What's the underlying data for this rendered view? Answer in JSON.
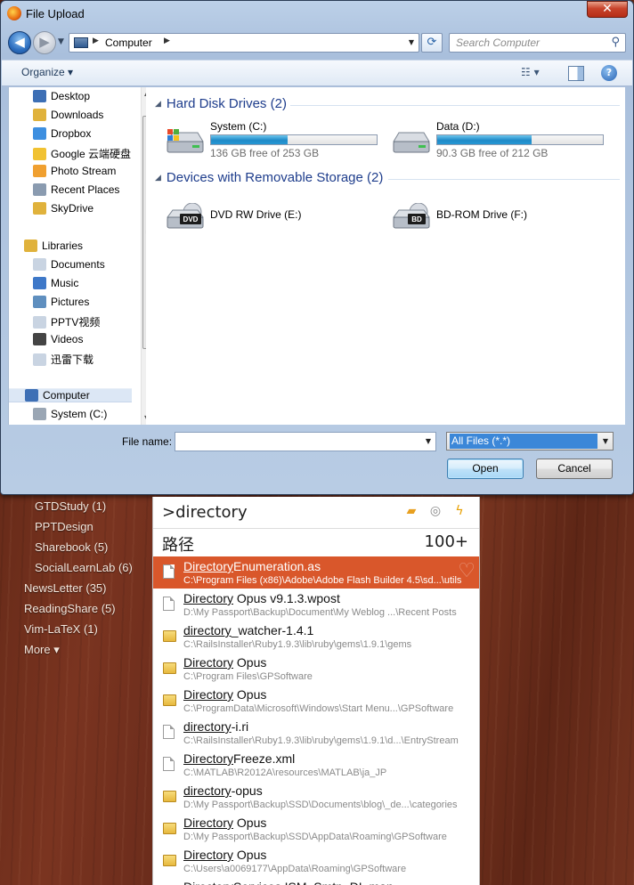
{
  "window": {
    "title": "File Upload",
    "close": "✕"
  },
  "nav": {
    "address_path": "Computer",
    "search_placeholder": "Search Computer"
  },
  "toolbar": {
    "organize_label": "Organize ▾",
    "view_label": "☷ ▾",
    "help_label": "?"
  },
  "sidebar": {
    "favorites": [
      {
        "label": "Desktop",
        "icon": "desktop-icon",
        "color": "#3d6fb5"
      },
      {
        "label": "Downloads",
        "icon": "downloads-folder-icon",
        "color": "#e0b23c"
      },
      {
        "label": "Dropbox",
        "icon": "dropbox-icon",
        "color": "#3d8fe0"
      },
      {
        "label": "Google 云端硬盘",
        "icon": "google-drive-icon",
        "color": "#f1c232"
      },
      {
        "label": "Photo Stream",
        "icon": "photo-stream-icon",
        "color": "#f0a030"
      },
      {
        "label": "Recent Places",
        "icon": "recent-places-icon",
        "color": "#8a9bb0"
      },
      {
        "label": "SkyDrive",
        "icon": "skydrive-folder-icon",
        "color": "#e0b23c"
      }
    ],
    "libraries_label": "Libraries",
    "libraries": [
      {
        "label": "Documents",
        "icon": "documents-icon",
        "color": "#c9d4e2"
      },
      {
        "label": "Music",
        "icon": "music-icon",
        "color": "#3e78c8"
      },
      {
        "label": "Pictures",
        "icon": "pictures-icon",
        "color": "#5f8fbf"
      },
      {
        "label": "PPTV视频",
        "icon": "video-library-icon",
        "color": "#c9d4e2"
      },
      {
        "label": "Videos",
        "icon": "videos-icon",
        "color": "#444444"
      },
      {
        "label": "迅雷下载",
        "icon": "download-library-icon",
        "color": "#c9d4e2"
      }
    ],
    "computer_label": "Computer",
    "computer_children": [
      {
        "label": "System (C:)",
        "icon": "system-drive-icon",
        "color": "#9aa6b4"
      }
    ]
  },
  "content": {
    "groups": [
      {
        "label": "Hard Disk Drives (2)"
      },
      {
        "label": "Devices with Removable Storage (2)"
      }
    ],
    "hard_drives": [
      {
        "name": "System (C:)",
        "free_text": "136 GB free of 253 GB",
        "used_fraction": 0.46
      },
      {
        "name": "Data (D:)",
        "free_text": "90.3 GB free of 212 GB",
        "used_fraction": 0.57
      }
    ],
    "removable": [
      {
        "name": "DVD RW Drive (E:)",
        "badge": "DVD"
      },
      {
        "name": "BD-ROM Drive (F:)",
        "badge": "BD"
      }
    ]
  },
  "footer": {
    "file_name_label": "File name:",
    "file_name_value": "",
    "file_type": "All Files (*.*)",
    "open_label": "Open",
    "cancel_label": "Cancel"
  },
  "left_list": [
    {
      "label": "GTDStudy (1)",
      "bold": true
    },
    {
      "label": "PPTDesign",
      "bold": false
    },
    {
      "label": "Sharebook (5)",
      "bold": true
    },
    {
      "label": "SocialLearnLab (6)",
      "bold": true
    },
    {
      "label": "NewsLetter (35)",
      "bold": true
    },
    {
      "label": "ReadingShare (5)",
      "bold": true
    },
    {
      "label": "Vim-LaTeX (1)",
      "bold": true
    },
    {
      "label": "More ▾",
      "bold": false
    }
  ],
  "launcher": {
    "query": ">directory",
    "category_title": "路径",
    "category_count": "100+",
    "results": [
      {
        "match": "Directory",
        "rest": "Enumeration.as",
        "path": "C:\\Program Files (x86)\\Adobe\\Adobe Flash Builder 4.5\\sd...\\utils",
        "kind": "file",
        "selected": true
      },
      {
        "match": "Directory",
        "rest": " Opus v9.1.3.wpost",
        "path": "D:\\My Passport\\Backup\\Document\\My Weblog ...\\Recent Posts",
        "kind": "file",
        "selected": false
      },
      {
        "match": "directory",
        "rest": "_watcher-1.4.1",
        "path": "C:\\RailsInstaller\\Ruby1.9.3\\lib\\ruby\\gems\\1.9.1\\gems",
        "kind": "folder",
        "selected": false
      },
      {
        "match": "Directory",
        "rest": " Opus",
        "path": "C:\\Program Files\\GPSoftware",
        "kind": "folder",
        "selected": false
      },
      {
        "match": "Directory",
        "rest": " Opus",
        "path": "C:\\ProgramData\\Microsoft\\Windows\\Start Menu...\\GPSoftware",
        "kind": "folder",
        "selected": false
      },
      {
        "match": "directory",
        "rest": "-i.ri",
        "path": "C:\\RailsInstaller\\Ruby1.9.3\\lib\\ruby\\gems\\1.9.1\\d...\\EntryStream",
        "kind": "file",
        "selected": false
      },
      {
        "match": "Directory",
        "rest": "Freeze.xml",
        "path": "C:\\MATLAB\\R2012A\\resources\\MATLAB\\ja_JP",
        "kind": "file",
        "selected": false
      },
      {
        "match": "directory",
        "rest": "-opus",
        "path": "D:\\My Passport\\Backup\\SSD\\Documents\\blog\\_de...\\categories",
        "kind": "folder",
        "selected": false
      },
      {
        "match": "Directory",
        "rest": " Opus",
        "path": "D:\\My Passport\\Backup\\SSD\\AppData\\Roaming\\GPSoftware",
        "kind": "folder",
        "selected": false
      },
      {
        "match": "Directory",
        "rest": " Opus",
        "path": "C:\\Users\\a0069177\\AppData\\Roaming\\GPSoftware",
        "kind": "folder",
        "selected": false
      },
      {
        "match": "Directory",
        "rest": "Services.ISM_Smtp_DL.man",
        "path": "",
        "kind": "file",
        "selected": false
      }
    ]
  }
}
